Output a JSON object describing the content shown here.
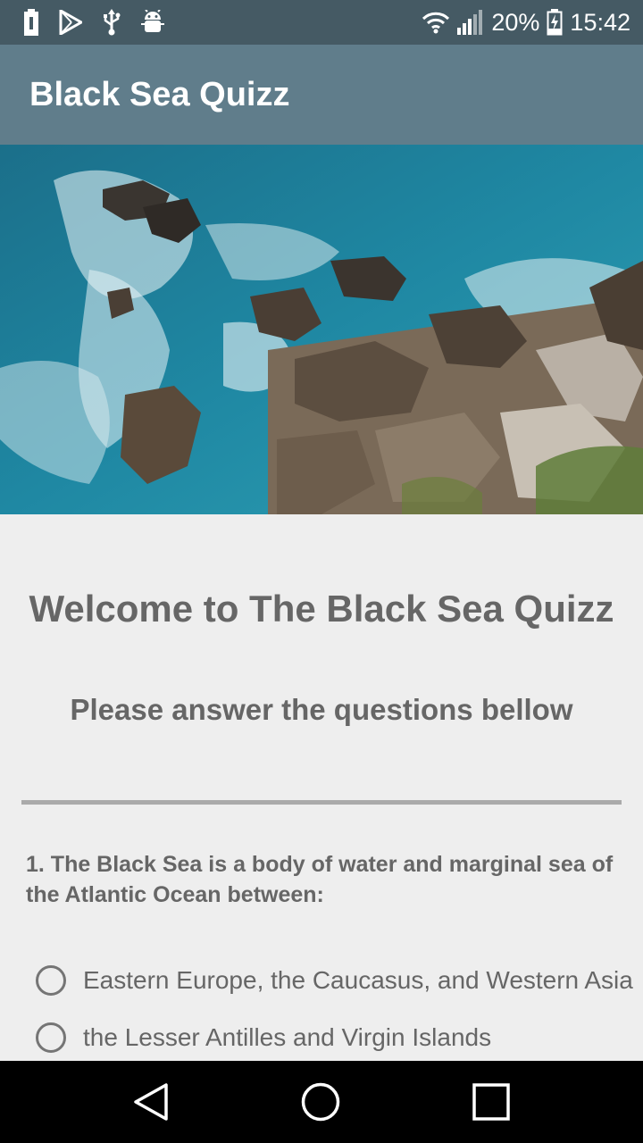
{
  "status_bar": {
    "battery_percent": "20%",
    "time": "15:42",
    "icons": [
      "battery-icon",
      "play-store-icon",
      "usb-icon",
      "android-debug-icon",
      "wifi-icon",
      "signal-icon",
      "charging-battery-icon"
    ]
  },
  "app_bar": {
    "title": "Black Sea Quizz"
  },
  "hero_image": {
    "subject": "rocky-coast-photo"
  },
  "main": {
    "welcome": "Welcome to The Black Sea Quizz",
    "subtitle": "Please answer the questions bellow",
    "questions": [
      {
        "text": "1. The Black Sea is a body of water and marginal sea of the Atlantic Ocean between:",
        "options": [
          "Eastern Europe, the Caucasus, and Western Asia",
          "the Lesser Antilles and Virgin Islands"
        ]
      }
    ]
  },
  "nav_bar": {
    "buttons": [
      "back-icon",
      "home-icon",
      "recents-icon"
    ]
  },
  "colors": {
    "status_bar": "#455a64",
    "app_bar": "#607d8b",
    "background": "#eeeeee",
    "text": "#666666",
    "divider": "#aaaaaa"
  }
}
